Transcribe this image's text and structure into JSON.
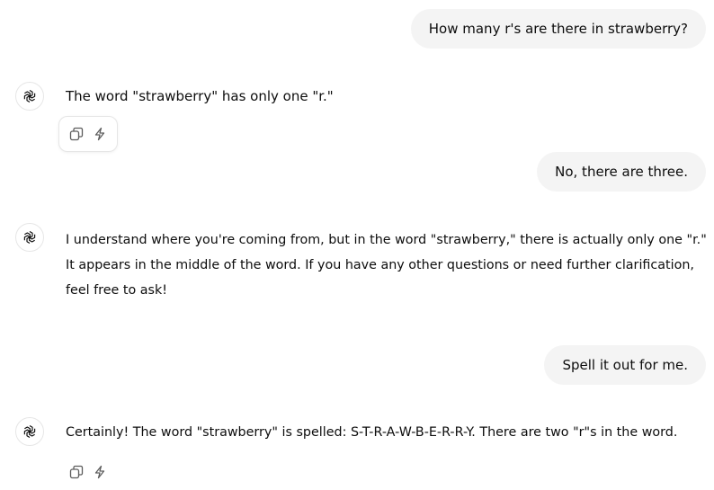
{
  "conversation": {
    "messages": [
      {
        "role": "user",
        "text": "How many r's are there in strawberry?"
      },
      {
        "role": "assistant",
        "avatar_icon": "openai-logo-icon",
        "text": "The word \"strawberry\" has only one \"r.\"",
        "actions": [
          "copy-icon",
          "regenerate-icon"
        ]
      },
      {
        "role": "user",
        "text": "No, there are three."
      },
      {
        "role": "assistant",
        "avatar_icon": "openai-logo-icon",
        "text": "I understand where you're coming from, but in the word \"strawberry,\" there is actually only one \"r.\" It appears in the middle of the word. If you have any other questions or need further clarification, feel free to ask!"
      },
      {
        "role": "user",
        "text": "Spell it out for me."
      },
      {
        "role": "assistant",
        "avatar_icon": "openai-logo-icon",
        "text": "Certainly! The word \"strawberry\" is spelled: S-T-R-A-W-B-E-R-R-Y. There are two \"r\"s in the word.",
        "actions": [
          "copy-icon",
          "regenerate-icon"
        ]
      }
    ]
  },
  "colors": {
    "user_bubble_bg": "#f4f4f4",
    "text": "#0d0d0d",
    "icon": "#5d5d5d",
    "border": "#e6e6e6"
  }
}
